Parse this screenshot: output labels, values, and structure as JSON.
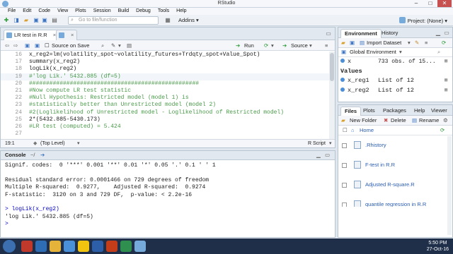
{
  "window": {
    "title": "RStudio",
    "min": "–",
    "max": "□",
    "close": "✕"
  },
  "menu": [
    "File",
    "Edit",
    "Code",
    "View",
    "Plots",
    "Session",
    "Build",
    "Debug",
    "Tools",
    "Help"
  ],
  "toolbar": {
    "goto_placeholder": "Go to file/function",
    "addins": "Addins",
    "project": "Project: (None)"
  },
  "editor": {
    "tabs": [
      {
        "label": "LR test in R.R"
      },
      {
        "label": ""
      }
    ],
    "source_on_save": "Source on Save",
    "run": "Run",
    "source": "Source",
    "lines": [
      {
        "n": "16",
        "text": "x_reg2=lm(volatility_spot~volatility_futures+Trdqty_spot+Value_Spot)",
        "comment": false
      },
      {
        "n": "17",
        "text": "summary(x_reg2)",
        "comment": false
      },
      {
        "n": "18",
        "text": "logLik(x_reg2)",
        "comment": false
      },
      {
        "n": "19",
        "text": "#'log Lik.' 5432.885 (df=5)",
        "comment": true
      },
      {
        "n": "20",
        "text": "##################################################",
        "comment": true
      },
      {
        "n": "21",
        "text": "#Now compute LR test statistic",
        "comment": true
      },
      {
        "n": "22",
        "text": "#Null Hypothesis: Restricted model (model 1) is",
        "comment": true
      },
      {
        "n": "23",
        "text": "#statistically better than Unrestricted model (model 2)",
        "comment": true
      },
      {
        "n": "24",
        "text": "#2(Loglikelihood of Unrestricted model - Loglikelihood of Restricted model)",
        "comment": true
      },
      {
        "n": "25",
        "text": "2*(5432.885-5430.173)",
        "comment": false
      },
      {
        "n": "26",
        "text": "#LR test (computed) = 5.424",
        "comment": true
      },
      {
        "n": "27",
        "text": "",
        "comment": false
      }
    ],
    "status_pos": "19:1",
    "status_level": "(Top Level)",
    "status_type": "R Script"
  },
  "console": {
    "title": "Console",
    "path": "~/",
    "lines": [
      {
        "text": "Signif. codes:  0 '***' 0.001 '**' 0.01 '*' 0.05 '.' 0.1 ' ' 1",
        "prompt": false
      },
      {
        "text": "",
        "prompt": false
      },
      {
        "text": "Residual standard error: 0.0001466 on 729 degrees of freedom",
        "prompt": false
      },
      {
        "text": "Multiple R-squared:  0.9277,    Adjusted R-squared:  0.9274",
        "prompt": false
      },
      {
        "text": "F-statistic:  3120 on 3 and 729 DF,  p-value: < 2.2e-16",
        "prompt": false
      },
      {
        "text": "",
        "prompt": false
      },
      {
        "text": "> logLik(x_reg2)",
        "prompt": true
      },
      {
        "text": "'log Lik.' 5432.885 (df=5)",
        "prompt": false
      },
      {
        "text": ">",
        "prompt": true
      }
    ]
  },
  "environment": {
    "tabs": [
      "Environment",
      "History"
    ],
    "import": "Import Dataset",
    "scope": "Global Environment",
    "rows": [
      {
        "name": "x",
        "value": "733 obs. of 15...",
        "header": false
      },
      {
        "name": "Values",
        "value": "",
        "header": true
      },
      {
        "name": "x_reg1",
        "value": "List of 12",
        "header": false
      },
      {
        "name": "x_reg2",
        "value": "List of 12",
        "header": false
      }
    ]
  },
  "files": {
    "tabs": [
      "Files",
      "Plots",
      "Packages",
      "Help",
      "Viewer"
    ],
    "new_folder": "New Folder",
    "delete": "Delete",
    "rename": "Rename",
    "home": "Home",
    "items": [
      ".Rhistory",
      "F-test in R.R",
      "Adjusted R-square.R",
      "quantile regression in R.R"
    ]
  },
  "taskbar": {
    "time": "5:50 PM",
    "date": "27-Oct-16"
  }
}
